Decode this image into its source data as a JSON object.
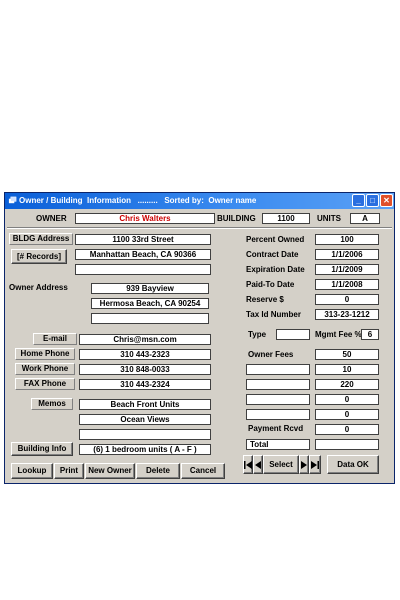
{
  "window": {
    "title": "Owner / Building  Information   .........   Sorted by:  Owner name"
  },
  "header": {
    "owner_label": "OWNER",
    "owner_value": "Chris Walters",
    "building_label": "BUILDING",
    "building_value": "1100",
    "units_label": "UNITS",
    "units_value": "A"
  },
  "left": {
    "bldg_address_label": "BLDG Address",
    "bldg_address_1": "1100 33rd Street",
    "bldg_address_2": "Manhattan Beach, CA 90366",
    "bldg_address_3": "",
    "records_button": "[# Records]",
    "owner_address_label": "Owner Address",
    "owner_address_1": "939 Bayview",
    "owner_address_2": "Hermosa Beach, CA 90254",
    "owner_address_3": "",
    "email_label": "E-mail",
    "email_value": "Chris@msn.com",
    "home_phone_label": "Home Phone",
    "home_phone_value": "310 443-2323",
    "work_phone_label": "Work Phone",
    "work_phone_value": "310 848-0033",
    "fax_phone_label": "FAX Phone",
    "fax_phone_value": "310 443-2324",
    "memos_label": "Memos",
    "memo_1": "Beach Front Units",
    "memo_2": "Ocean Views",
    "memo_3": "",
    "building_info_button": "Building Info",
    "building_info_value": "(6) 1 bedroom units ( A - F )"
  },
  "right": {
    "percent_owned_label": "Percent Owned",
    "percent_owned_value": "100",
    "contract_date_label": "Contract  Date",
    "contract_date_value": "1/1/2006",
    "expiration_date_label": "Expiration Date",
    "expiration_date_value": "1/1/2009",
    "paid_to_date_label": "Paid-To  Date",
    "paid_to_date_value": "1/1/2008",
    "reserve_label": "Reserve $",
    "reserve_value": "0",
    "tax_id_label": "Tax Id Number",
    "tax_id_value": "313-23-1212",
    "type_label": "Type",
    "type_value": "",
    "mgmt_fee_label": "Mgmt Fee %",
    "mgmt_fee_value": "6",
    "owner_fees_label": "Owner Fees",
    "fee_1": "50",
    "fee_2": "10",
    "fee_3": "220",
    "fee_4": "0",
    "fee_5": "0",
    "payment_rcvd_label": "Payment Rcvd",
    "payment_rcvd_value": "0",
    "total_label": "Total",
    "total_value": ""
  },
  "toolbar": {
    "lookup": "Lookup",
    "print": "Print",
    "new_owner": "New Owner",
    "delete": "Delete",
    "cancel": "Cancel",
    "select": "Select",
    "data_ok": "Data  OK"
  }
}
